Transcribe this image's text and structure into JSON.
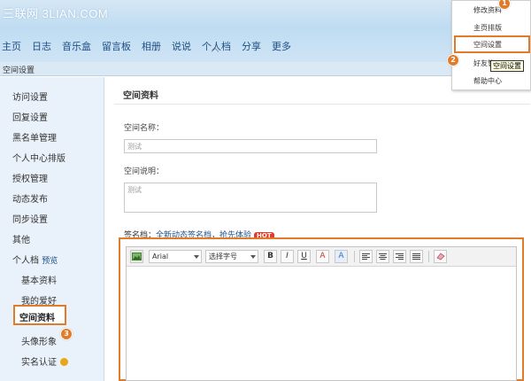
{
  "header": {
    "logo": "三联网 3LIAN.COM",
    "nav": [
      "主页",
      "日志",
      "音乐盒",
      "留言板",
      "相册",
      "说说",
      "个人档",
      "分享",
      "更多"
    ]
  },
  "breadcrumb": "空间设置",
  "dropdown": {
    "items": [
      "修改资料",
      "主页排版",
      "空间设置",
      "好友管",
      "帮助中心"
    ],
    "tooltip": "空间设置"
  },
  "sidebar": {
    "items": [
      "访问设置",
      "回复设置",
      "黑名单管理",
      "个人中心排版",
      "授权管理",
      "动态发布",
      "同步设置",
      "其他"
    ],
    "profile_group": "个人档",
    "profile_tag": "预览",
    "sub_items": [
      "基本资料",
      "我的爱好",
      "空间资料",
      "头像形象",
      "实名认证"
    ]
  },
  "main": {
    "title": "空间资料",
    "name_label": "空间名称：",
    "name_value": "测试",
    "desc_label": "空间说明：",
    "desc_value": "测试",
    "sig_prefix": "签名档：",
    "sig_link": "全新动态签名档，抢先体验",
    "hot_badge": "HOT"
  },
  "editor": {
    "font": "Arial",
    "size_placeholder": "选择字号",
    "buttons": [
      "B",
      "I",
      "U",
      "A",
      "A"
    ]
  },
  "steps": [
    "1",
    "2",
    "3"
  ],
  "colors": {
    "accent": "#e07b2a",
    "nav_text": "#1f4f86",
    "sidebar_bg": "#e9f2fa"
  }
}
